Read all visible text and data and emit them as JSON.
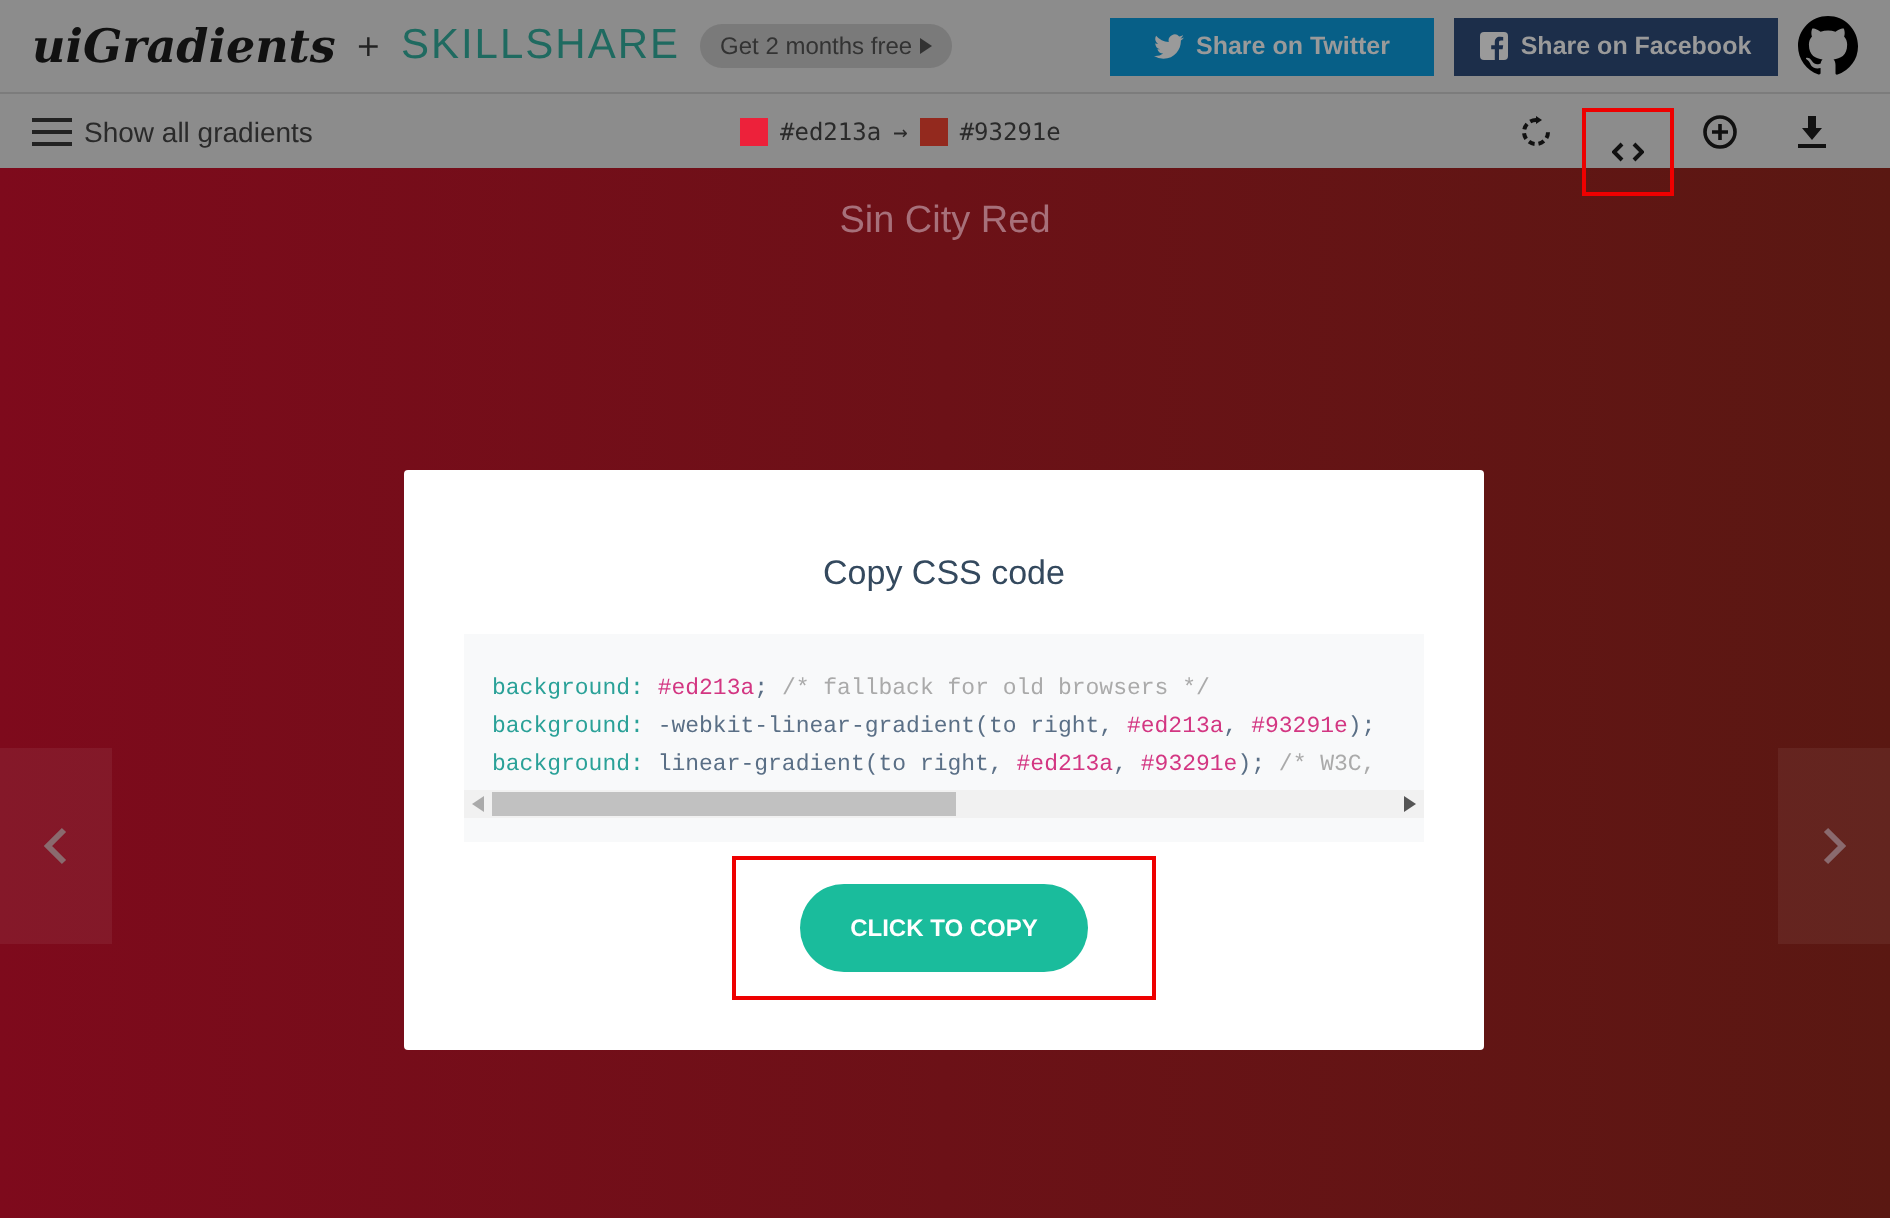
{
  "header": {
    "logo": "uiGradients",
    "plus": "+",
    "partner": "SKILLSHARE",
    "promo": "Get 2 months free",
    "share_buttons": [
      {
        "kind": "twitter",
        "label": "Share on Twitter"
      },
      {
        "kind": "facebook",
        "label": "Share on Facebook"
      }
    ]
  },
  "toolbar": {
    "menu_label": "Show all gradients",
    "colors": [
      {
        "hex": "#ed213a",
        "color": "#ed213a"
      },
      {
        "hex": "#93291e",
        "color": "#93291e"
      }
    ],
    "arrow": "→",
    "actions": [
      {
        "kind": "rotate",
        "highlighted": false
      },
      {
        "kind": "code",
        "highlighted": true
      },
      {
        "kind": "add",
        "highlighted": false
      },
      {
        "kind": "download",
        "highlighted": false
      }
    ]
  },
  "gradient": {
    "name": "Sin City Red"
  },
  "modal": {
    "title": "Copy CSS code",
    "code_lines": [
      [
        {
          "kind": "property",
          "text": "background:"
        },
        {
          "kind": "hex",
          "text": " #ed213a"
        },
        {
          "kind": "plain",
          "text": ";"
        },
        {
          "kind": "comment",
          "text": " /* fallback for old browsers */"
        }
      ],
      [
        {
          "kind": "property",
          "text": "background:"
        },
        {
          "kind": "plain",
          "text": " -webkit-linear-gradient(to right, "
        },
        {
          "kind": "hex",
          "text": "#ed213a"
        },
        {
          "kind": "plain",
          "text": ", "
        },
        {
          "kind": "hex",
          "text": "#93291e"
        },
        {
          "kind": "plain",
          "text": ");"
        }
      ],
      [
        {
          "kind": "property",
          "text": "background:"
        },
        {
          "kind": "plain",
          "text": " linear-gradient(to right, "
        },
        {
          "kind": "hex",
          "text": "#ed213a"
        },
        {
          "kind": "plain",
          "text": ", "
        },
        {
          "kind": "hex",
          "text": "#93291e"
        },
        {
          "kind": "plain",
          "text": ");"
        },
        {
          "kind": "comment",
          "text": " /* W3C,"
        }
      ]
    ],
    "copy_button": {
      "label": "CLICK TO COPY",
      "highlighted": true
    }
  }
}
